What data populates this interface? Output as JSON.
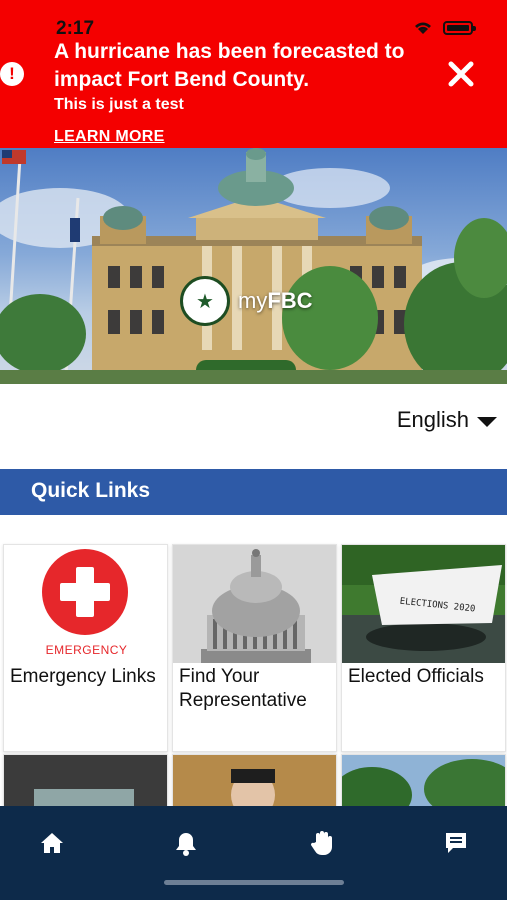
{
  "status_bar": {
    "time": "2:17"
  },
  "alert": {
    "icon": "exclamation-circle-icon",
    "headline": "A hurricane has been forecasted to impact Fort Bend County.",
    "subtext": "This is just a test",
    "link_label": "LEARN MORE",
    "color": "#f40000"
  },
  "hero": {
    "brand_prefix": "my",
    "brand_suffix": "FBC"
  },
  "language": {
    "selected": "English"
  },
  "quick_links": {
    "title": "Quick Links",
    "bar_color": "#2e5aa7",
    "tiles": [
      {
        "label": "Emergency Links",
        "caption": "EMERGENCY"
      },
      {
        "label": "Find Your Representative"
      },
      {
        "label": "Elected Officials",
        "image_text": "ELECTIONS 2020"
      }
    ]
  },
  "bottom_nav": {
    "items": [
      "home-icon",
      "bell-icon",
      "hand-icon",
      "chat-icon"
    ],
    "color": "#0d2a4a"
  }
}
